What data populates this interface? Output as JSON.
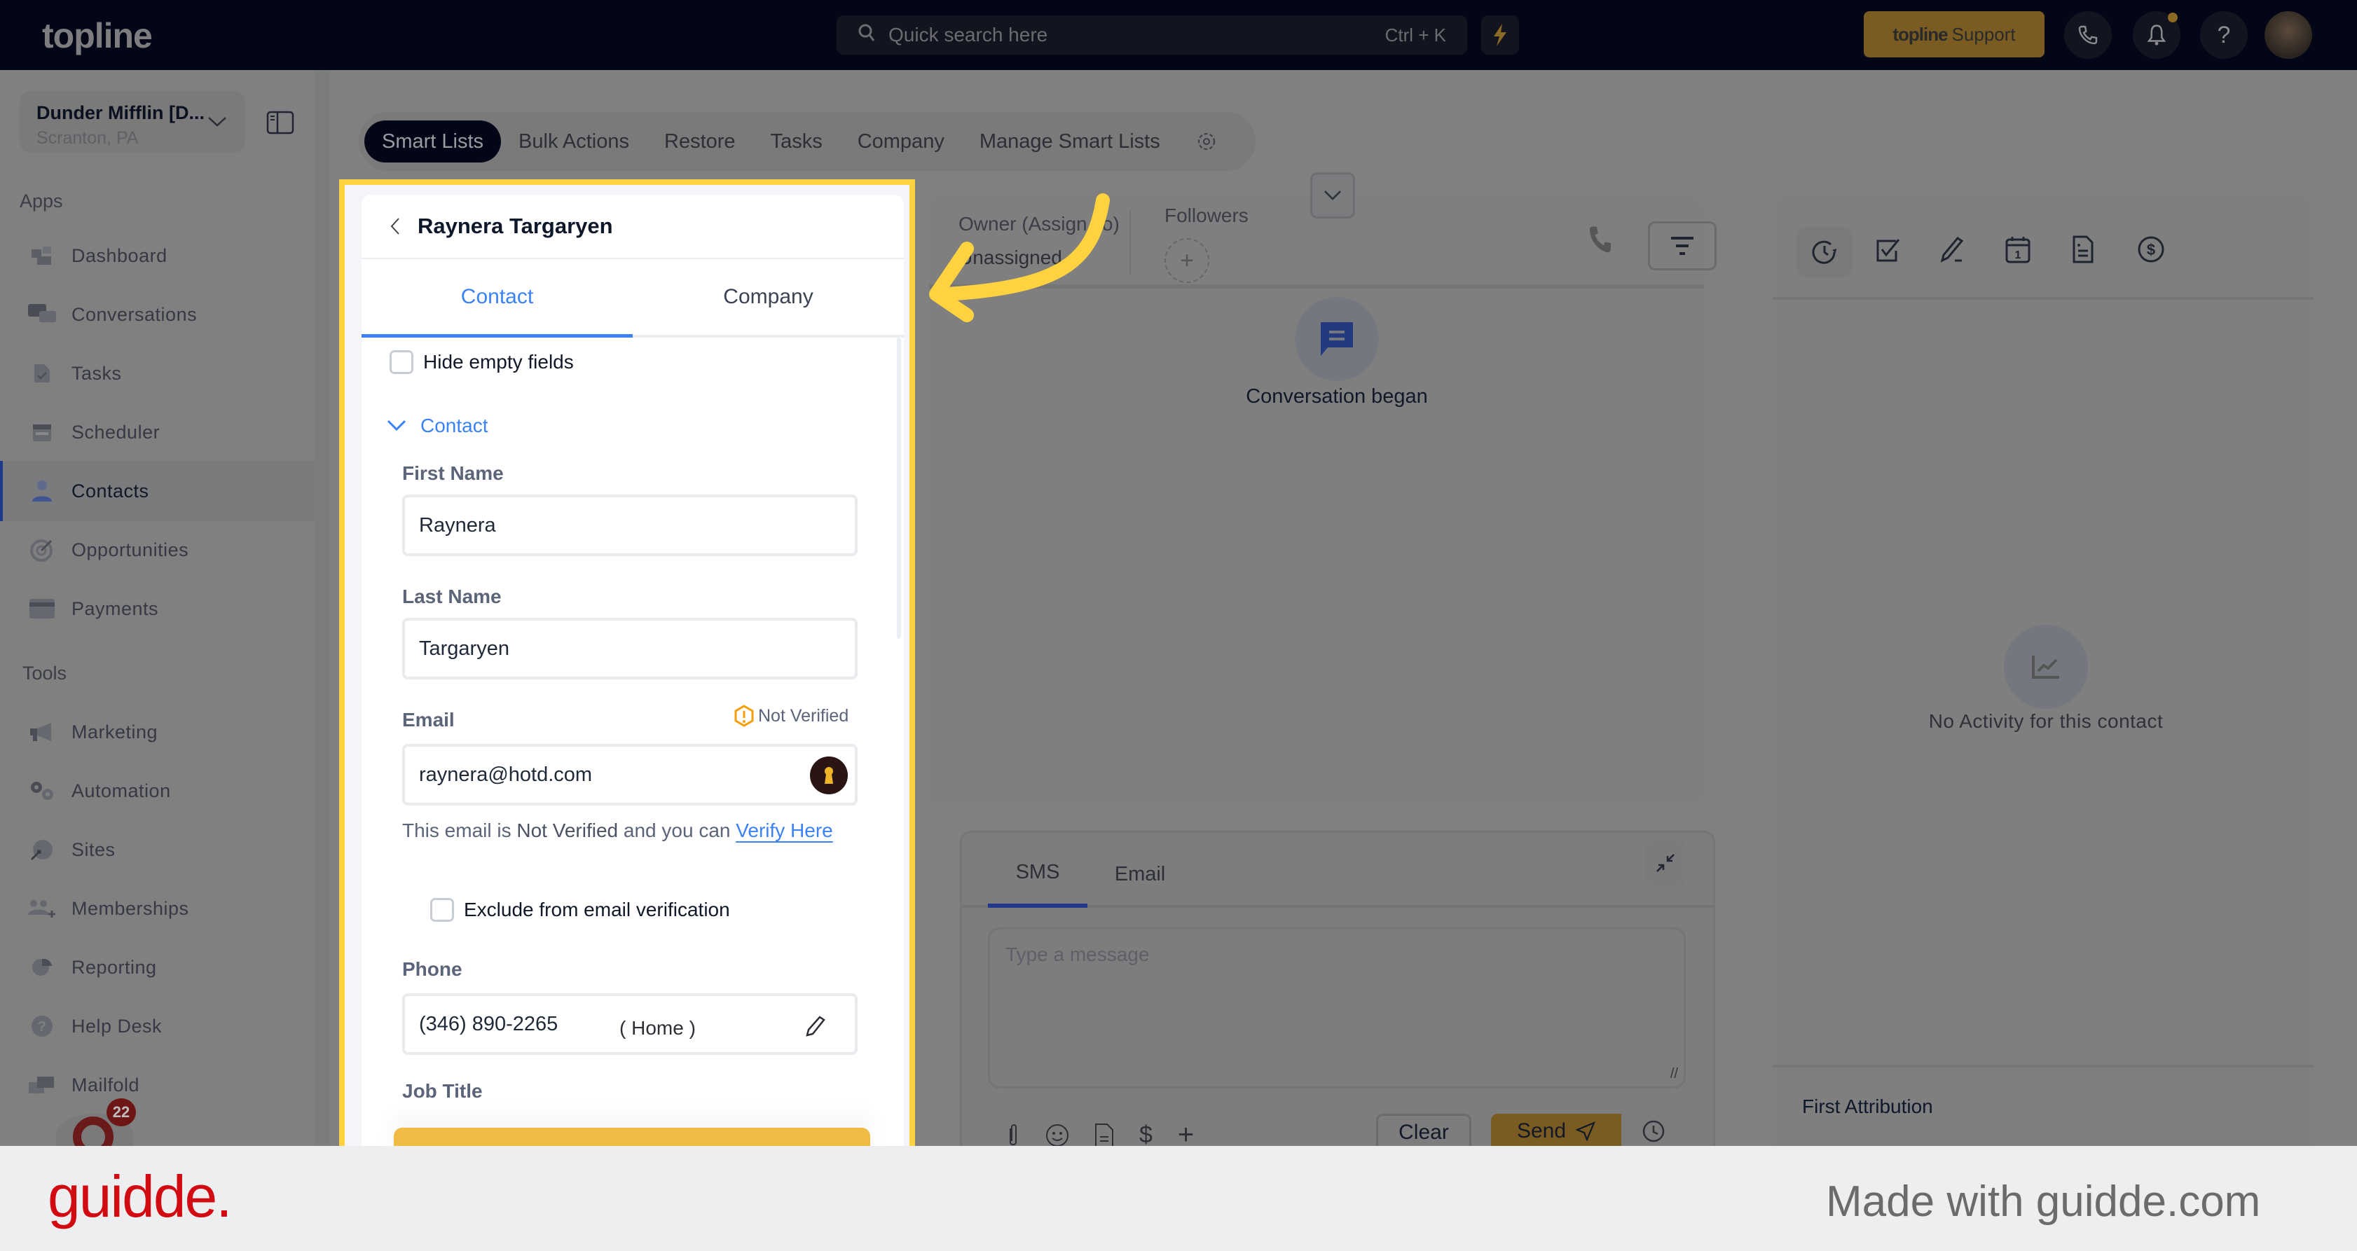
{
  "topbar": {
    "logo": "topline",
    "search_placeholder": "Quick search here",
    "search_shortcut": "Ctrl + K",
    "support_brand": "topline",
    "support_label": "Support",
    "icons": [
      "bolt-icon",
      "phone-icon",
      "bell-icon",
      "help-icon",
      "user-avatar"
    ]
  },
  "sidebar": {
    "org_name": "Dunder Mifflin [D...",
    "org_location": "Scranton, PA",
    "apps_label": "Apps",
    "tools_label": "Tools",
    "apps": [
      {
        "label": "Dashboard",
        "icon": "dashboard-icon"
      },
      {
        "label": "Conversations",
        "icon": "chat-icon"
      },
      {
        "label": "Tasks",
        "icon": "task-icon"
      },
      {
        "label": "Scheduler",
        "icon": "calendar-icon"
      },
      {
        "label": "Contacts",
        "icon": "user-icon",
        "active": true
      },
      {
        "label": "Opportunities",
        "icon": "target-icon"
      },
      {
        "label": "Payments",
        "icon": "credit-card-icon"
      }
    ],
    "tools": [
      {
        "label": "Marketing",
        "icon": "megaphone-icon"
      },
      {
        "label": "Automation",
        "icon": "gears-icon"
      },
      {
        "label": "Sites",
        "icon": "globe-icon"
      },
      {
        "label": "Memberships",
        "icon": "users-icon"
      },
      {
        "label": "Reporting",
        "icon": "pie-chart-icon"
      },
      {
        "label": "Help Desk",
        "icon": "question-icon"
      },
      {
        "label": "Mailfold",
        "icon": "mail-icon"
      }
    ],
    "badge_count": "22"
  },
  "tabs": [
    {
      "label": "Smart Lists",
      "active": true
    },
    {
      "label": "Bulk Actions"
    },
    {
      "label": "Restore"
    },
    {
      "label": "Tasks"
    },
    {
      "label": "Company"
    },
    {
      "label": "Manage Smart Lists"
    }
  ],
  "contact_panel": {
    "name": "Raynera Targaryen",
    "tabs": [
      "Contact",
      "Company"
    ],
    "active_tab": "Contact",
    "hide_empty_label": "Hide empty fields",
    "section_label": "Contact",
    "first_name_label": "First Name",
    "first_name": "Raynera",
    "last_name_label": "Last Name",
    "last_name": "Targaryen",
    "email_label": "Email",
    "email_status": "Not Verified",
    "email": "raynera@hotd.com",
    "email_note_prefix": "This email is ",
    "email_note_bold": "Not Verified",
    "email_note_mid": " and you can ",
    "verify_link": "Verify Here",
    "exclude_label": "Exclude from email verification",
    "phone_label": "Phone",
    "phone": "(346) 890-2265",
    "phone_type": "( Home )",
    "job_title_label": "Job Title"
  },
  "conversation": {
    "owner_label": "Owner (Assign To)",
    "owner_value": "Unassigned",
    "followers_label": "Followers",
    "event": "Conversation began",
    "composer_tabs": [
      "SMS",
      "Email"
    ],
    "active_composer_tab": "SMS",
    "message_placeholder": "Type a message",
    "clear_label": "Clear",
    "send_label": "Send"
  },
  "activity": {
    "empty_text": "No Activity for this contact",
    "attribution_title": "First Attribution",
    "toolbar_icons": [
      "activity-history-icon",
      "task-check-icon",
      "note-pen-icon",
      "calendar-icon",
      "document-icon",
      "dollar-icon"
    ]
  },
  "footer": {
    "brand": "guidde.",
    "made_with": "Made with guidde.com"
  },
  "colors": {
    "accent_blue": "#3b82f6",
    "highlight_yellow": "#ffd23f",
    "brand_red": "#d20a11",
    "topbar_bg": "#020617"
  }
}
